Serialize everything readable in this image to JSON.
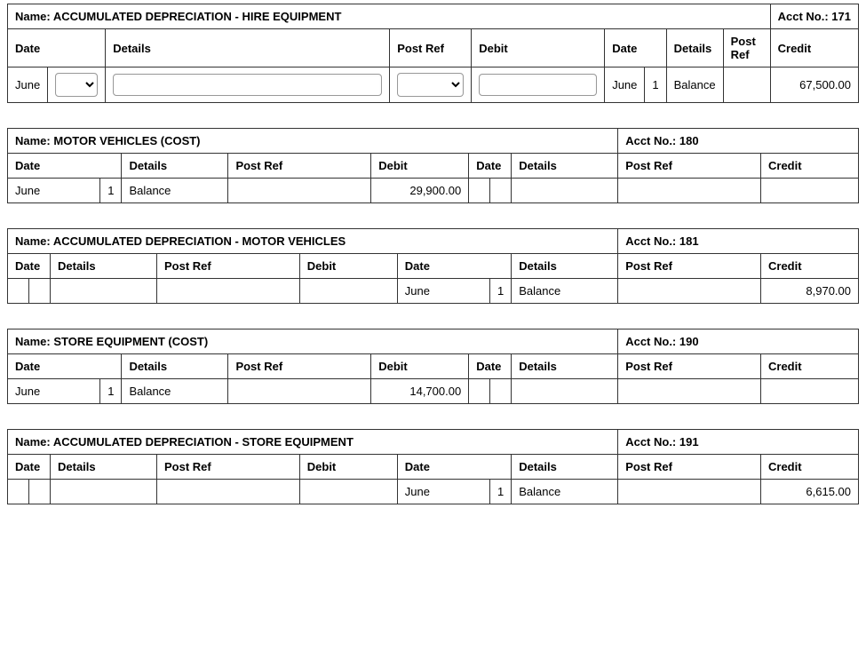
{
  "headers": {
    "date": "Date",
    "details": "Details",
    "postref": "Post Ref",
    "debit": "Debit",
    "credit": "Credit",
    "name_prefix": "Name: ",
    "acct_prefix": "Acct No.: "
  },
  "ledgers": [
    {
      "name": "ACCUMULATED DEPRECIATION - HIRE EQUIPMENT",
      "acct_no": "171",
      "editable": true,
      "debit_row": {
        "month": "June",
        "day": "",
        "details": "",
        "postref": "",
        "amount": ""
      },
      "credit_row": {
        "month": "June",
        "day": "1",
        "details": "Balance",
        "postref": "",
        "amount": "67,500.00"
      }
    },
    {
      "name": "MOTOR VEHICLES (COST)",
      "acct_no": "180",
      "editable": false,
      "debit_row": {
        "month": "June",
        "day": "1",
        "details": "Balance",
        "postref": "",
        "amount": "29,900.00"
      },
      "credit_row": {
        "month": "",
        "day": "",
        "details": "",
        "postref": "",
        "amount": ""
      }
    },
    {
      "name": "ACCUMULATED DEPRECIATION - MOTOR VEHICLES",
      "acct_no": "181",
      "editable": false,
      "debit_row": {
        "month": "",
        "day": "",
        "details": "",
        "postref": "",
        "amount": ""
      },
      "credit_row": {
        "month": "June",
        "day": "1",
        "details": "Balance",
        "postref": "",
        "amount": "8,970.00"
      }
    },
    {
      "name": "STORE EQUIPMENT (COST)",
      "acct_no": "190",
      "editable": false,
      "debit_row": {
        "month": "June",
        "day": "1",
        "details": "Balance",
        "postref": "",
        "amount": "14,700.00"
      },
      "credit_row": {
        "month": "",
        "day": "",
        "details": "",
        "postref": "",
        "amount": ""
      }
    },
    {
      "name": "ACCUMULATED DEPRECIATION - STORE EQUIPMENT",
      "acct_no": "191",
      "editable": false,
      "debit_row": {
        "month": "",
        "day": "",
        "details": "",
        "postref": "",
        "amount": ""
      },
      "credit_row": {
        "month": "June",
        "day": "1",
        "details": "Balance",
        "postref": "",
        "amount": "6,615.00"
      }
    }
  ]
}
